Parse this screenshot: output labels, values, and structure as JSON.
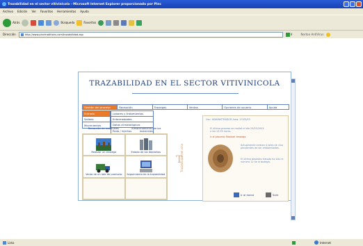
{
  "window": {
    "title": "Trazabilidad en el sector vitivinicola - Microsoft Internet Explorer proporcionado por Pinc"
  },
  "menubar": [
    "Archivo",
    "Edición",
    "Ver",
    "Favoritos",
    "Herramientas",
    "Ayuda"
  ],
  "toolbar": {
    "back_label": "Atrás",
    "search_label": "Búsqueda",
    "favorites_label": "Favoritos"
  },
  "address": {
    "label": "Dirección",
    "url": "http://www.pinctraditions.com/trazabilidad.asp",
    "go_label": "Ir",
    "links_label": "Norton AntiVirus"
  },
  "status": {
    "left": "Listo",
    "right": "Internet"
  },
  "app": {
    "title": "TRAZABILIDAD EN EL SECTOR VITIVINICOLA",
    "nav": [
      "Gestión del proceso",
      "Recepción",
      "Trasiegos",
      "Ventas",
      "Opciones de usuario",
      "Ayuda"
    ],
    "submenu1": [
      "Entrada",
      "Salidas",
      "Movimientos"
    ],
    "submenu2": [
      "Labores y tratamientos",
      "Enfermedades",
      "Datos climatológicos",
      "Poda / injertos"
    ],
    "grid_top_labels": [
      "Recepción de materiales",
      "Almacenamiento de los materiales"
    ],
    "grid_cells": [
      {
        "label": "Realizar un trasiego",
        "icon": "vineyard-icon"
      },
      {
        "label": "Estado de los depósitos",
        "icon": "tank-icon"
      },
      {
        "label": "Venta de un lote de producto",
        "icon": "truck-icon"
      },
      {
        "label": "Seguimiento de la trazabilidad",
        "icon": "computer-icon"
      }
    ],
    "vertical_text": "Trazabilidad del vino",
    "panel": {
      "user_line": "Usu: ADMINISTRADOR   Area: 27/05/03",
      "msg1": "El último proceso se realizó el día 25/05/2003 a las 13:55 horas.",
      "msg2": "Ir al proceso: Realizar trasiego",
      "msg3": "Actualmente existen 4 lotes de vino pendientes de ser embotellados.",
      "msg4": "El último depósito tratado ha sido el número 12 de la bodega.",
      "menu_btn": "Ir al menú",
      "exit_btn": "Salir"
    }
  },
  "colors": {
    "accent": "#e87a2a",
    "nav_text": "#1c3a7a",
    "border": "#5f7fb8"
  }
}
